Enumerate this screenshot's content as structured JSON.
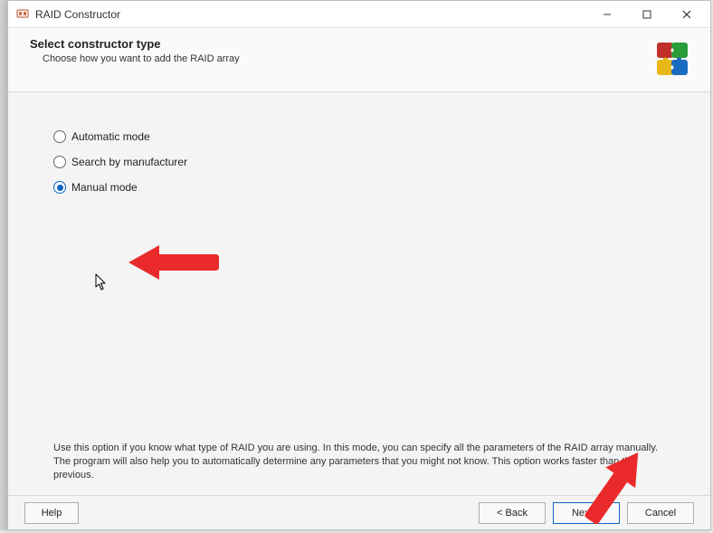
{
  "window": {
    "title": "RAID Constructor"
  },
  "header": {
    "heading": "Select constructor type",
    "subheading": "Choose how you want to add the RAID array"
  },
  "options": {
    "automatic": {
      "label": "Automatic mode",
      "selected": false
    },
    "search": {
      "label": "Search by manufacturer",
      "selected": false
    },
    "manual": {
      "label": "Manual mode",
      "selected": true
    }
  },
  "description": "Use this option if you know what type of RAID you are using. In this mode, you can specify all the parameters of the RAID array manually. The program will also help you to automatically determine any parameters that you might not know. This option works faster than the previous.",
  "footer": {
    "help": "Help",
    "back": "< Back",
    "next": "Next >",
    "cancel": "Cancel"
  },
  "colors": {
    "accent": "#0a64c2",
    "annotation": "#ea2a2a"
  }
}
